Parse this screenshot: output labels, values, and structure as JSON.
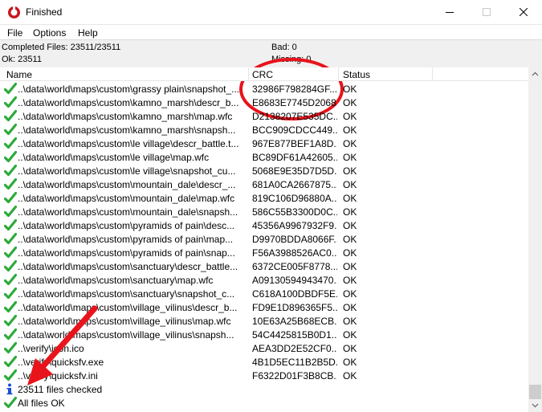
{
  "window": {
    "title": "Finished",
    "icon": "quicksfv-app-icon"
  },
  "menu": {
    "file": "File",
    "options": "Options",
    "help": "Help"
  },
  "summary": {
    "completed": "Completed Files: 23511/23511",
    "ok": "Ok: 23511",
    "bad": "Bad: 0",
    "missing": "Missing: 0"
  },
  "columns": {
    "name": "Name",
    "crc": "CRC",
    "status": "Status"
  },
  "rows": [
    {
      "name": "..\\data\\world\\maps\\custom\\grassy plain\\snapshot_...",
      "crc": "32986F798284GF...",
      "status": "OK"
    },
    {
      "name": "..\\data\\world\\maps\\custom\\kamno_marsh\\descr_b...",
      "crc": "E8683E7745D2068...",
      "status": "OK"
    },
    {
      "name": "..\\data\\world\\maps\\custom\\kamno_marsh\\map.wfc",
      "crc": "D2138207E535DC...",
      "status": "OK"
    },
    {
      "name": "..\\data\\world\\maps\\custom\\kamno_marsh\\snapsh...",
      "crc": "BCC909CDCC449...",
      "status": "OK"
    },
    {
      "name": "..\\data\\world\\maps\\custom\\le village\\descr_battle.t...",
      "crc": "967E877BEF1A8D...",
      "status": "OK"
    },
    {
      "name": "..\\data\\world\\maps\\custom\\le village\\map.wfc",
      "crc": "BC89DF61A42605...",
      "status": "OK"
    },
    {
      "name": "..\\data\\world\\maps\\custom\\le village\\snapshot_cu...",
      "crc": "5068E9E35D7D5D...",
      "status": "OK"
    },
    {
      "name": "..\\data\\world\\maps\\custom\\mountain_dale\\descr_...",
      "crc": "681A0CA2667875...",
      "status": "OK"
    },
    {
      "name": "..\\data\\world\\maps\\custom\\mountain_dale\\map.wfc",
      "crc": "819C106D96880A...",
      "status": "OK"
    },
    {
      "name": "..\\data\\world\\maps\\custom\\mountain_dale\\snapsh...",
      "crc": "586C55B3300D0C...",
      "status": "OK"
    },
    {
      "name": "..\\data\\world\\maps\\custom\\pyramids of pain\\desc...",
      "crc": "45356A9967932F9...",
      "status": "OK"
    },
    {
      "name": "..\\data\\world\\maps\\custom\\pyramids of pain\\map...",
      "crc": "D9970BDDA8066F...",
      "status": "OK"
    },
    {
      "name": "..\\data\\world\\maps\\custom\\pyramids of pain\\snap...",
      "crc": "F56A3988526AC0...",
      "status": "OK"
    },
    {
      "name": "..\\data\\world\\maps\\custom\\sanctuary\\descr_battle...",
      "crc": "6372CE005F8778...",
      "status": "OK"
    },
    {
      "name": "..\\data\\world\\maps\\custom\\sanctuary\\map.wfc",
      "crc": "A09130594943470...",
      "status": "OK"
    },
    {
      "name": "..\\data\\world\\maps\\custom\\sanctuary\\snapshot_c...",
      "crc": "C618A100DBDF5E...",
      "status": "OK"
    },
    {
      "name": "..\\data\\world\\maps\\custom\\village_vilinus\\descr_b...",
      "crc": "FD9E1D896365F5...",
      "status": "OK"
    },
    {
      "name": "..\\data\\world\\maps\\custom\\village_vilinus\\map.wfc",
      "crc": "10E63A25B68ECB...",
      "status": "OK"
    },
    {
      "name": "..\\data\\world\\maps\\custom\\village_vilinus\\snapsh...",
      "crc": "54C4425815B0D1...",
      "status": "OK"
    },
    {
      "name": "..\\verify\\icon.ico",
      "crc": "AEA3DD2E52CF0...",
      "status": "OK"
    },
    {
      "name": "..\\verify\\quicksfv.exe",
      "crc": "4B1D5EC11B2B5D...",
      "status": "OK"
    },
    {
      "name": "..\\verify\\quicksfv.ini",
      "crc": "F6322D01F3B8CB...",
      "status": "OK"
    }
  ],
  "info": {
    "files_checked": "23511 files checked",
    "all_ok": "All files OK"
  },
  "colors": {
    "check_green": "#2eaa3b",
    "annotation_red": "#e8131b",
    "info_blue": "#1c4fd8"
  },
  "icons": {
    "status_ok": "green-check-icon",
    "info": "info-icon"
  }
}
